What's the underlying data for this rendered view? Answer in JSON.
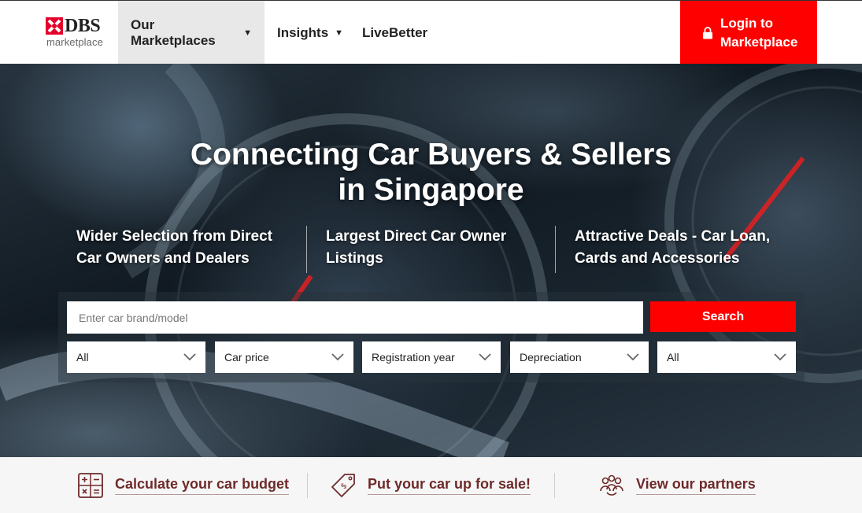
{
  "header": {
    "logo": {
      "brand": "DBS",
      "sub": "marketplace"
    },
    "nav": [
      {
        "label": "Our Marketplaces",
        "has_caret": true,
        "active": true
      },
      {
        "label": "Insights",
        "has_caret": true,
        "active": false
      },
      {
        "label": "LiveBetter",
        "has_caret": false,
        "active": false
      }
    ],
    "login": {
      "line1": "Login to",
      "line2": "Marketplace",
      "icon": "lock-icon"
    }
  },
  "hero": {
    "title_line1": "Connecting Car Buyers & Sellers",
    "title_line2": "in Singapore",
    "features": [
      {
        "line1": "Wider Selection from Direct",
        "line2": "Car Owners and Dealers"
      },
      {
        "line1": "Largest Direct Car Owner",
        "line2": "Listings"
      },
      {
        "line1": "Attractive Deals - Car Loan,",
        "line2": "Cards and Accessories"
      }
    ]
  },
  "search": {
    "placeholder": "Enter car brand/model",
    "button_label": "Search",
    "filters": [
      {
        "value": "All"
      },
      {
        "value": "Car price"
      },
      {
        "value": "Registration year"
      },
      {
        "value": "Depreciation"
      },
      {
        "value": "All"
      }
    ]
  },
  "bottom": {
    "links": [
      {
        "label": "Calculate your car budget",
        "icon": "calculator-icon"
      },
      {
        "label": "Put your car up for sale!",
        "icon": "price-tag-icon"
      },
      {
        "label": "View our partners",
        "icon": "partners-icon"
      }
    ]
  },
  "colors": {
    "brand_red": "#ff0000",
    "link_maroon": "#6e2a2a",
    "nav_active_bg": "#e8e8e8"
  }
}
